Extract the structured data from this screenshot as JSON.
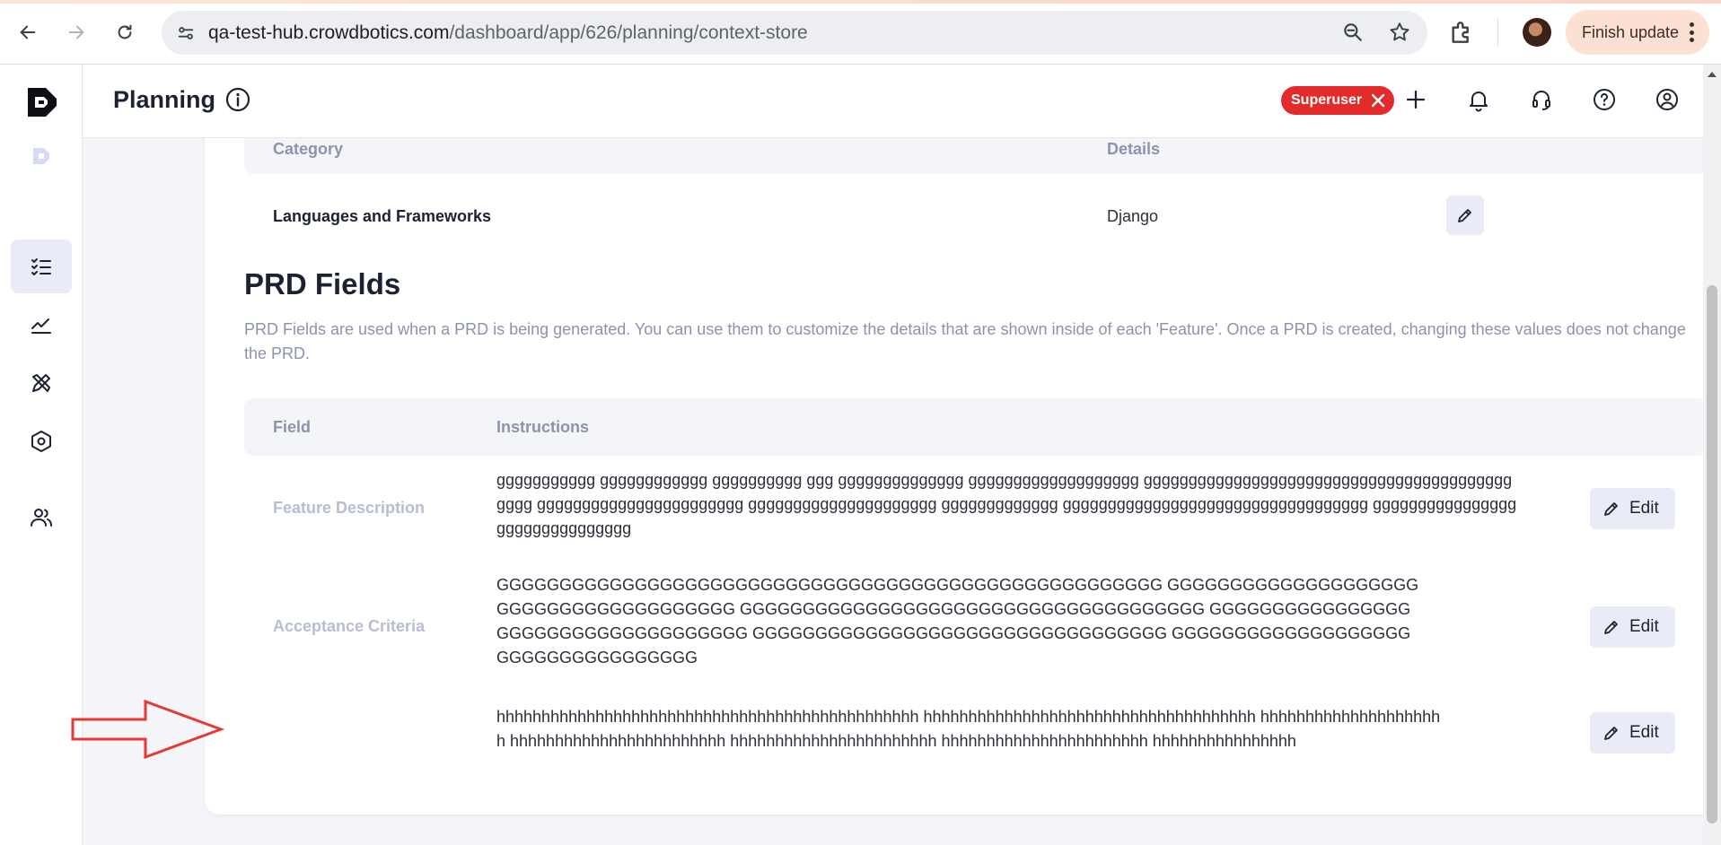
{
  "browser": {
    "url_domain": "qa-test-hub.crowdbotics.com",
    "url_path": "/dashboard/app/626/planning/context-store",
    "finish_update_label": "Finish update"
  },
  "app": {
    "page_title": "Planning",
    "superuser_label": "Superuser"
  },
  "context_table": {
    "headers": [
      "Category",
      "Details"
    ],
    "rows": [
      {
        "category": "Languages and Frameworks",
        "details": "Django"
      }
    ]
  },
  "prd": {
    "title": "PRD Fields",
    "description": "PRD Fields are used when a PRD is being generated. You can use them to customize the details that are shown inside of each 'Feature'. Once a PRD is created, changing these values does not change the PRD.",
    "headers": [
      "Field",
      "Instructions"
    ],
    "edit_label": "Edit",
    "rows": [
      {
        "field": "Feature Description",
        "instructions": "ggggggggggg gggggggggggg gggggggggg ggg gggggggggggggg ggggggggggggggggggg ggggggggggggggggggggggggggggggggggggggggggggg ggggggggggggggggggggggg ggggggggggggggggggggg ggggggggggggg gggggggggggggggggggggggggggggggggg gggggggggggggggg ggggggggggggggg"
      },
      {
        "field": "Acceptance Criteria",
        "instructions": "GGGGGGGGGGGGGGGGGGGGGGGGGGGGGGGGGGGGGGGGGGGGGGGGGGGGG GGGGGGGGGGGGGGGGGGGGGGGGGGGGGGGGGGGGGGG GGGGGGGGGGGGGGGGGGGGGGGGGGGGGGGGGGGGG GGGGGGGGGGGGGGGGGGGGGGGGGGGGGGGGGGGG GGGGGGGGGGGGGGGGGGGGGGGGGGGGGGGGG GGGGGGGGGGGGGGGGGGGGGGGGGGGGGGGGGGG"
      },
      {
        "field": "",
        "instructions": "hhhhhhhhhhhhhhhhhhhhhhhhhhhhhhhhhhhhhhhhhhhhhhh hhhhhhhhhhhhhhhhhhhhhhhhhhhhhhhhhhhhh hhhhhhhhhhhhhhhhhhhhh hhhhhhhhhhhhhhhhhhhhhhhh hhhhhhhhhhhhhhhhhhhhhhh hhhhhhhhhhhhhhhhhhhhhhh hhhhhhhhhhhhhhhh"
      }
    ]
  }
}
